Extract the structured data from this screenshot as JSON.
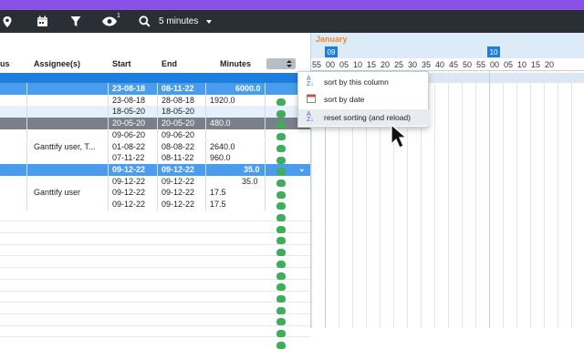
{
  "toolbar": {
    "items": [
      "location-icon",
      "calendar-icon",
      "filter-icon",
      "eye-icon",
      "search-icon"
    ],
    "eye_badge": "1",
    "zoom_label": "5 minutes"
  },
  "columns": {
    "c0": "us",
    "assignee": "Assignee(s)",
    "start": "Start",
    "end": "End",
    "minutes": "Minutes"
  },
  "rows": [
    {
      "assignee": "",
      "start": "23-08-18",
      "end": "08-11-22",
      "minutes": "6000.0",
      "style": "sel"
    },
    {
      "assignee": "",
      "start": "23-08-18",
      "end": "28-08-18",
      "minutes": "1920.0",
      "style": "normal"
    },
    {
      "assignee": "",
      "start": "18-05-20",
      "end": "18-05-20",
      "minutes": "",
      "style": "light"
    },
    {
      "assignee": "",
      "start": "20-05-20",
      "end": "20-05-20",
      "minutes": "480.0",
      "style": "grey"
    },
    {
      "assignee": "",
      "start": "09-06-20",
      "end": "09-06-20",
      "minutes": "",
      "style": "normal"
    },
    {
      "assignee": "Ganttify user, T...",
      "start": "01-08-22",
      "end": "08-08-22",
      "minutes": "2640.0",
      "style": "normal"
    },
    {
      "assignee": "",
      "start": "07-11-22",
      "end": "08-11-22",
      "minutes": "960.0",
      "style": "normal"
    },
    {
      "assignee": "",
      "start": "09-12-22",
      "end": "09-12-22",
      "minutes": "35.0",
      "style": "sel"
    },
    {
      "assignee": "",
      "start": "09-12-22",
      "end": "09-12-22",
      "minutes": "35.0",
      "style": "normal"
    },
    {
      "assignee": "Ganttify user",
      "start": "09-12-22",
      "end": "09-12-22",
      "minutes": "17.5",
      "style": "normal"
    },
    {
      "assignee": "",
      "start": "09-12-22",
      "end": "09-12-22",
      "minutes": "17.5",
      "style": "normal"
    }
  ],
  "timeline": {
    "month": "January",
    "hours": [
      "09",
      "10"
    ],
    "minutes": [
      "55",
      "00",
      "05",
      "10",
      "15",
      "20",
      "25",
      "30",
      "35",
      "40",
      "45",
      "50",
      "55",
      "00",
      "05",
      "10",
      "15",
      "20"
    ]
  },
  "context_menu": {
    "items": [
      {
        "label": "sort by this column",
        "icon": "sort-az-icon"
      },
      {
        "label": "sort by date",
        "icon": "calendar-sort-icon"
      },
      {
        "label": "reset sorting (and reload)",
        "icon": "sort-reset-icon"
      }
    ]
  },
  "colors": {
    "accent": "#1c7fe0",
    "toolbar": "#2a2f36",
    "topbar": "#8a4fe6",
    "month_label": "#f08a24",
    "status_icon": "#3fae5a"
  }
}
